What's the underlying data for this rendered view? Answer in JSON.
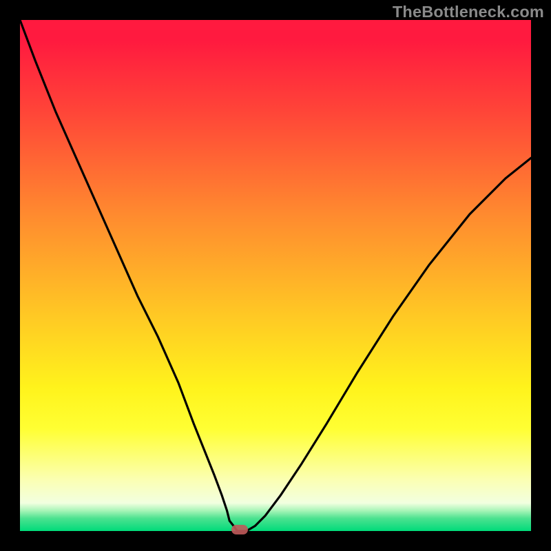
{
  "watermark": "TheBottleneck.com",
  "colors": {
    "frame": "#000000",
    "gradient_top": "#ff1a3f",
    "gradient_bottom": "#00db7a",
    "curve": "#000000",
    "marker": "#c05a5a"
  },
  "chart_data": {
    "type": "line",
    "title": "",
    "xlabel": "",
    "ylabel": "",
    "xlim": [
      0,
      100
    ],
    "ylim": [
      0,
      100
    ],
    "x": [
      0,
      3,
      7,
      11,
      15,
      19,
      23,
      27,
      31,
      34,
      36,
      38,
      39.5,
      40.5,
      41,
      41.8,
      42.5,
      44.3,
      46,
      48,
      51,
      55,
      60,
      66,
      73,
      80,
      88,
      95,
      100
    ],
    "values": [
      100,
      92,
      82,
      73,
      64,
      55,
      46,
      38,
      29,
      21,
      16,
      11,
      7,
      4,
      2,
      1,
      0,
      0,
      1,
      3,
      7,
      13,
      21,
      31,
      42,
      52,
      62,
      69,
      73
    ],
    "optimum_x": 43,
    "optimum_y": 0,
    "annotations": []
  }
}
